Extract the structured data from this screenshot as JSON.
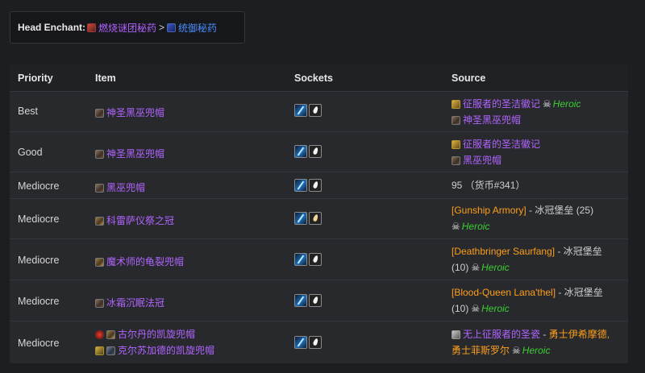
{
  "enchant": {
    "label": "Head Enchant:",
    "option1": "燃烧谜团秘药",
    "separator": ">",
    "option2": "统御秘药"
  },
  "table": {
    "headers": {
      "priority": "Priority",
      "item": "Item",
      "sockets": "Sockets",
      "source": "Source"
    },
    "rows": [
      {
        "priority": "Best",
        "items": [
          {
            "name": "神圣黑巫兜帽"
          }
        ],
        "source": [
          {
            "text": "征服者的圣洁徽记",
            "heroic": "Heroic"
          },
          {
            "text": "神圣黑巫兜帽"
          }
        ]
      },
      {
        "priority": "Good",
        "items": [
          {
            "name": "神圣黑巫兜帽"
          }
        ],
        "source": [
          {
            "text": "征服者的圣洁徽记"
          },
          {
            "text": "黑巫兜帽"
          }
        ]
      },
      {
        "priority": "Mediocre",
        "items": [
          {
            "name": "黑巫兜帽"
          }
        ],
        "source_text": "95 （货币#341）"
      },
      {
        "priority": "Mediocre",
        "items": [
          {
            "name": "科雷萨仪祭之冠"
          }
        ],
        "source": {
          "boss": "[Gunship Armory]",
          "dash": " - ",
          "zone": "冰冠堡垒",
          "size": " (25)",
          "heroic": "Heroic"
        }
      },
      {
        "priority": "Mediocre",
        "items": [
          {
            "name": "魔术师的龟裂兜帽"
          }
        ],
        "source": {
          "boss": "[Deathbringer Saurfang]",
          "dash": " - ",
          "zone": "冰冠堡垒",
          "size": "(10)",
          "heroic": "Heroic"
        }
      },
      {
        "priority": "Mediocre",
        "items": [
          {
            "name": "冰霜沉眠法冠"
          }
        ],
        "source": {
          "boss": "[Blood-Queen Lana'thel]",
          "dash": " - ",
          "zone": "冰冠堡垒",
          "size": "(10)",
          "heroic": "Heroic"
        }
      },
      {
        "priority": "Mediocre",
        "items": [
          {
            "name": "古尔丹的凯旋兜帽"
          },
          {
            "name": "克尔苏加德的凯旋兜帽"
          }
        ],
        "source": {
          "line1": "无上征服者的圣瓷",
          "dash": " - ",
          "npc1": "勇士伊希摩德,",
          "npc2": "勇士菲斯罗尔",
          "heroic": "Heroic"
        }
      }
    ]
  },
  "colors": {
    "background": "#1d1e21",
    "table_background": "#27292d",
    "item_purple": "#b264ff",
    "boss_orange": "#ff9f1a",
    "heroic_green": "#3ccf30",
    "enchant_blue": "#4a8cff"
  },
  "icons": {
    "enchant1": "red-flask-icon",
    "enchant2": "blue-flask-icon",
    "socket_meta": "meta-gem-icon",
    "socket_prismatic": "prismatic-gem-icon",
    "heroic": "skull-icon"
  }
}
